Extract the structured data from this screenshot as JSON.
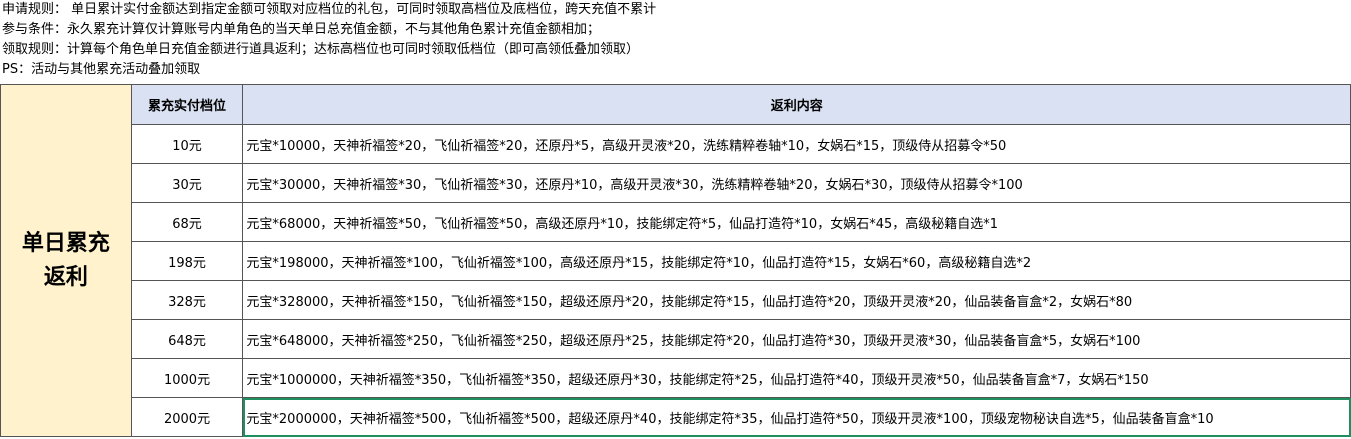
{
  "rules": [
    "申请规则： 单日累计实付金额达到指定金额可领取对应档位的礼包，可同时领取高档位及底档位，跨天充值不累计",
    "参与条件：永久累充计算仅计算账号内单角色的当天单日总充值金额，不与其他角色累计充值金额相加；",
    "领取规则：计算每个角色单日充值金额进行道具返利；达标高档位也可同时领取低档位（即可高领低叠加领取）",
    "PS：活动与其他累充活动叠加领取"
  ],
  "table": {
    "side_label": "单日累充\n返利",
    "headers": {
      "tier": "累充实付档位",
      "content": "返利内容"
    },
    "rows": [
      {
        "tier": "10元",
        "content": "元宝*10000，天神祈福签*20，飞仙祈福签*20，还原丹*5，高级开灵液*20，洗练精粹卷轴*10，女娲石*15，顶级侍从招募令*50"
      },
      {
        "tier": "30元",
        "content": "元宝*30000，天神祈福签*30，飞仙祈福签*30，还原丹*10，高级开灵液*30，洗练精粹卷轴*20，女娲石*30，顶级侍从招募令*100"
      },
      {
        "tier": "68元",
        "content": "元宝*68000，天神祈福签*50，飞仙祈福签*50，高级还原丹*10，技能绑定符*5，仙品打造符*10，女娲石*45，高级秘籍自选*1"
      },
      {
        "tier": "198元",
        "content": "元宝*198000，天神祈福签*100，飞仙祈福签*100，高级还原丹*15，技能绑定符*10，仙品打造符*15，女娲石*60，高级秘籍自选*2"
      },
      {
        "tier": "328元",
        "content": "元宝*328000，天神祈福签*150，飞仙祈福签*150，超级还原丹*20，技能绑定符*15，仙品打造符*20，顶级开灵液*20，仙品装备盲盒*2，女娲石*80"
      },
      {
        "tier": "648元",
        "content": "元宝*648000，天神祈福签*250，飞仙祈福签*250，超级还原丹*25，技能绑定符*20，仙品打造符*30，顶级开灵液*30，仙品装备盲盒*5，女娲石*100"
      },
      {
        "tier": "1000元",
        "content": "元宝*1000000，天神祈福签*350，飞仙祈福签*350，超级还原丹*30，技能绑定符*25，仙品打造符*40，顶级开灵液*50，仙品装备盲盒*7，女娲石*150"
      },
      {
        "tier": "2000元",
        "content": "元宝*2000000，天神祈福签*500，飞仙祈福签*500，超级还原丹*40，技能绑定符*35，仙品打造符*50，顶级开灵液*100，顶级宠物秘诀自选*5，仙品装备盲盒*10"
      }
    ]
  },
  "colors": {
    "side_bg": "#fff2cc",
    "header_bg": "#d9e1f2",
    "selection": "#1f8f5f"
  }
}
